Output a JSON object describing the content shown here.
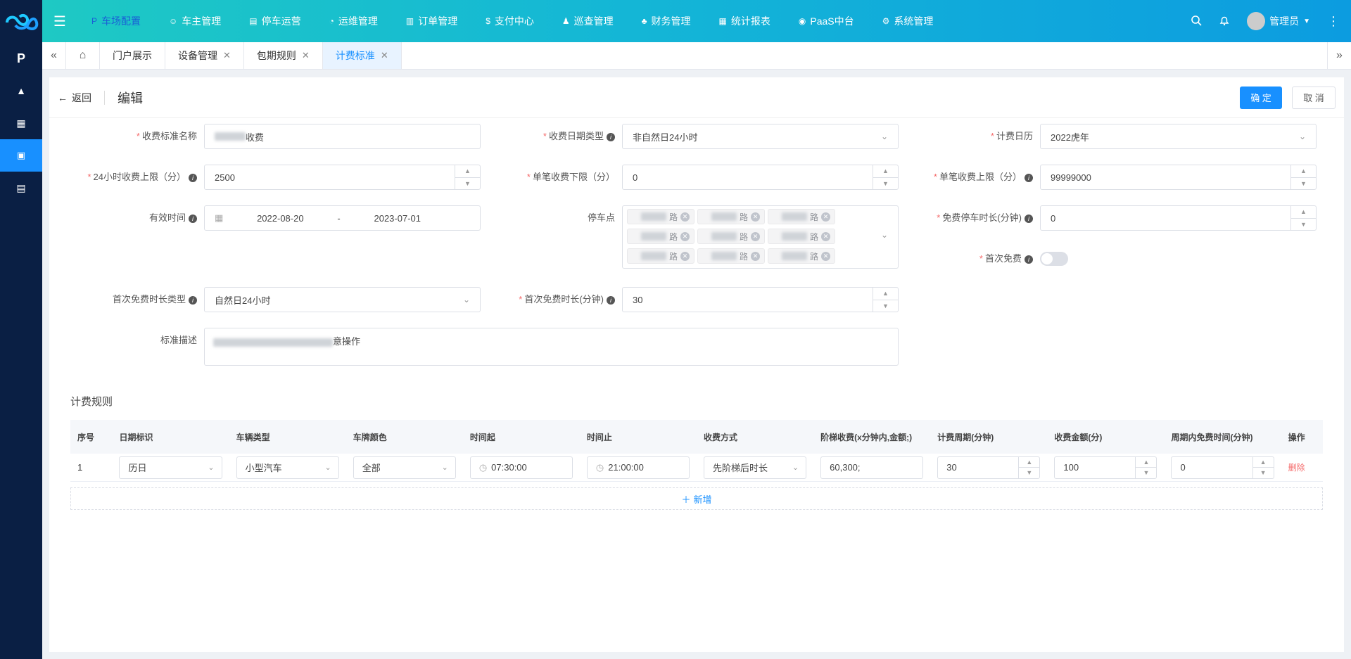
{
  "nav": {
    "items": [
      {
        "label": "车场配置",
        "icon": "P"
      },
      {
        "label": "车主管理",
        "icon": "☺"
      },
      {
        "label": "停车运营",
        "icon": "▤"
      },
      {
        "label": "运维管理",
        "icon": "◔"
      },
      {
        "label": "订单管理",
        "icon": "▥"
      },
      {
        "label": "支付中心",
        "icon": "$"
      },
      {
        "label": "巡查管理",
        "icon": "♟"
      },
      {
        "label": "财务管理",
        "icon": "♣"
      },
      {
        "label": "统计报表",
        "icon": "▦"
      },
      {
        "label": "PaaS中台",
        "icon": "◉"
      },
      {
        "label": "系统管理",
        "icon": "⚙"
      }
    ],
    "user": "管理员"
  },
  "tabs": {
    "items": [
      {
        "label": "门户展示",
        "closable": false
      },
      {
        "label": "设备管理",
        "closable": true
      },
      {
        "label": "包期规则",
        "closable": true
      },
      {
        "label": "计费标准",
        "closable": true,
        "active": true
      }
    ]
  },
  "page": {
    "back": "返回",
    "title": "编辑",
    "confirm": "确 定",
    "cancel": "取 消"
  },
  "form": {
    "name_label": "收费标准名称",
    "name_value": "收费",
    "datetype_label": "收费日期类型",
    "datetype_value": "非自然日24小时",
    "calendar_label": "计费日历",
    "calendar_value": "2022虎年",
    "cap24_label": "24小时收费上限（分）",
    "cap24_value": "2500",
    "min_label": "单笔收费下限（分）",
    "min_value": "0",
    "max_label": "单笔收费上限（分）",
    "max_value": "99999000",
    "valid_label": "有效时间",
    "valid_start": "2022-08-20",
    "valid_sep": "-",
    "valid_end": "2023-07-01",
    "park_label": "停车点",
    "park_tags": [
      "路",
      "路",
      "路",
      "路",
      "路",
      "路",
      "路",
      "路",
      "路"
    ],
    "freedur_label": "免费停车时长(分钟)",
    "freedur_value": "0",
    "firstfree_label": "首次免费",
    "firsttype_label": "首次免费时长类型",
    "firsttype_value": "自然日24小时",
    "firstdur_label": "首次免费时长(分钟)",
    "firstdur_value": "30",
    "desc_label": "标准描述",
    "desc_value": "意操作"
  },
  "rules": {
    "title": "计费规则",
    "headers": [
      "序号",
      "日期标识",
      "车辆类型",
      "车牌颜色",
      "时间起",
      "时间止",
      "收费方式",
      "阶梯收费(x分钟内,金额;)",
      "计费周期(分钟)",
      "收费金额(分)",
      "周期内免费时间(分钟)",
      "操作"
    ],
    "rows": [
      {
        "index": "1",
        "date": "历日",
        "vehicle": "小型汽车",
        "color": "全部",
        "start": "07:30:00",
        "end": "21:00:00",
        "mode": "先阶梯后时长",
        "ladder": "60,300;",
        "period": "30",
        "amount": "100",
        "free": "0",
        "action": "删除"
      }
    ],
    "add": "新增"
  }
}
